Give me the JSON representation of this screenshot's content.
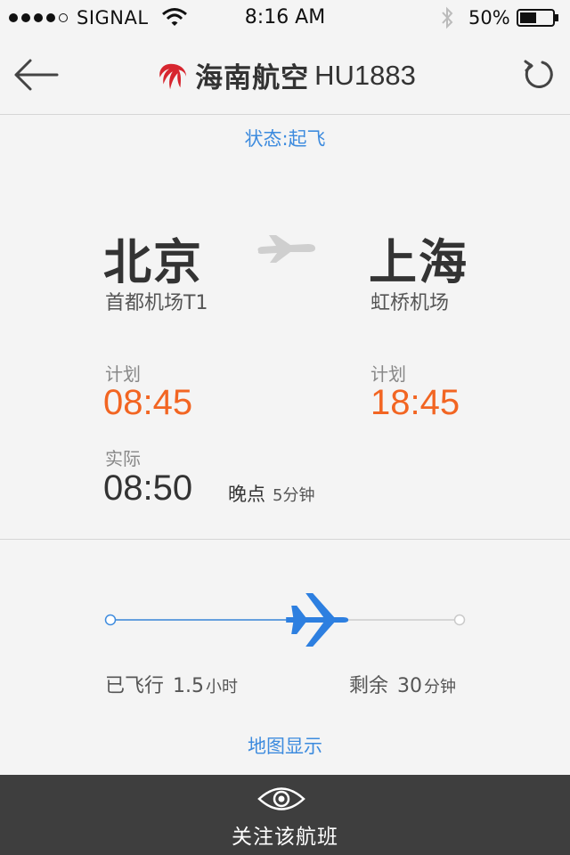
{
  "status_bar": {
    "carrier": "SIGNAL",
    "time": "8:16 AM",
    "battery": "50%",
    "battery_level": 0.5
  },
  "header": {
    "airline_name": "海南航空",
    "flight_number": "HU1883",
    "icons": {
      "back": "back-arrow-icon",
      "refresh": "refresh-icon",
      "logo": "hainan-airlines-logo"
    }
  },
  "flight": {
    "status": "状态:起飞",
    "origin": {
      "city": "北京",
      "airport": "首都机场T1"
    },
    "destination": {
      "city": "上海",
      "airport": "虹桥机场"
    },
    "departure": {
      "scheduled_label": "计划",
      "scheduled_time": "08:45",
      "actual_label": "实际",
      "actual_time": "08:50",
      "delay_label": "晚点",
      "delay_value": "5分钟"
    },
    "arrival": {
      "scheduled_label": "计划",
      "scheduled_time": "18:45"
    }
  },
  "progress": {
    "fraction": 0.6,
    "flown_label": "已飞行",
    "flown_value": "1.5",
    "flown_unit": "小时",
    "remaining_label": "剩余",
    "remaining_value": "30",
    "remaining_unit": "分钟",
    "map_link": "地图显示"
  },
  "footer": {
    "follow_label": "关注该航班",
    "icon": "eye-icon"
  },
  "colors": {
    "accent_blue": "#3d8bde",
    "time_orange": "#f26522",
    "footer_bg": "#3e3e3e",
    "airline_red": "#d7262f"
  }
}
